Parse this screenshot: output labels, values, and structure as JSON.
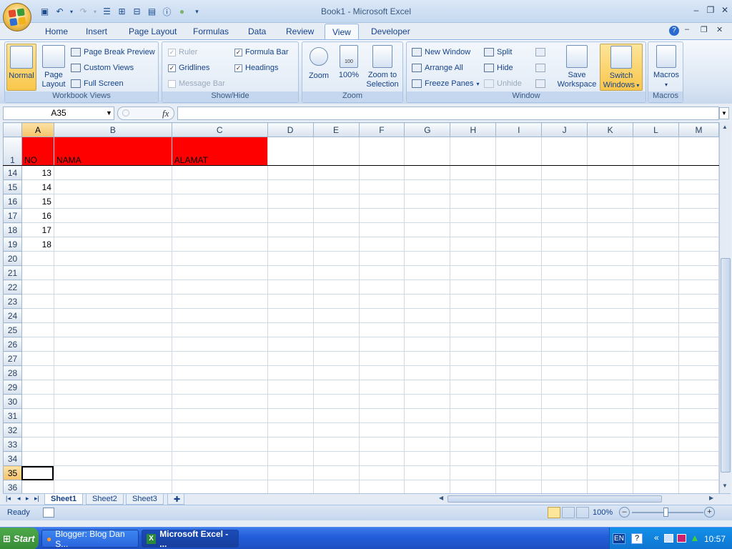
{
  "window": {
    "title": "Book1 - Microsoft Excel"
  },
  "quick_access": [
    "save-icon",
    "undo-icon",
    "redo-icon",
    "form-icon",
    "table-icon",
    "grid-icon",
    "chart-icon",
    "help-icon",
    "circle-icon"
  ],
  "tabs": [
    "Home",
    "Insert",
    "Page Layout",
    "Formulas",
    "Data",
    "Review",
    "View",
    "Developer"
  ],
  "active_tab": "View",
  "ribbon": {
    "workbook_views": {
      "label": "Workbook Views",
      "normal": "Normal",
      "page_layout_1": "Page",
      "page_layout_2": "Layout",
      "page_break_preview": "Page Break Preview",
      "custom_views": "Custom Views",
      "full_screen": "Full Screen"
    },
    "show_hide": {
      "label": "Show/Hide",
      "ruler": "Ruler",
      "gridlines": "Gridlines",
      "message_bar": "Message Bar",
      "formula_bar": "Formula Bar",
      "headings": "Headings",
      "check": "✓"
    },
    "zoom": {
      "label": "Zoom",
      "zoom": "Zoom",
      "hundred": "100%",
      "zoom_to_1": "Zoom to",
      "zoom_to_2": "Selection",
      "badge": "100"
    },
    "window": {
      "label": "Window",
      "new_window": "New Window",
      "arrange_all": "Arrange All",
      "freeze_panes": "Freeze Panes",
      "split": "Split",
      "hide": "Hide",
      "unhide": "Unhide",
      "save_ws_1": "Save",
      "save_ws_2": "Workspace",
      "switch_1": "Switch",
      "switch_2": "Windows"
    },
    "macros": {
      "label": "Macros",
      "macros": "Macros"
    }
  },
  "formula_bar": {
    "name_box": "A35",
    "fx": "fx",
    "value": ""
  },
  "grid": {
    "columns": [
      "A",
      "B",
      "C",
      "D",
      "E",
      "F",
      "G",
      "H",
      "I",
      "J",
      "K",
      "L",
      "M"
    ],
    "header_row": {
      "row": "1",
      "no": "NO",
      "nama": "NAMA",
      "alamat": "ALAMAT"
    },
    "rows": [
      {
        "row": "14",
        "a": "13"
      },
      {
        "row": "15",
        "a": "14"
      },
      {
        "row": "16",
        "a": "15"
      },
      {
        "row": "17",
        "a": "16"
      },
      {
        "row": "18",
        "a": "17"
      },
      {
        "row": "19",
        "a": "18"
      },
      {
        "row": "20",
        "a": ""
      },
      {
        "row": "21",
        "a": ""
      },
      {
        "row": "22",
        "a": ""
      },
      {
        "row": "23",
        "a": ""
      },
      {
        "row": "24",
        "a": ""
      },
      {
        "row": "25",
        "a": ""
      },
      {
        "row": "26",
        "a": ""
      },
      {
        "row": "27",
        "a": ""
      },
      {
        "row": "28",
        "a": ""
      },
      {
        "row": "29",
        "a": ""
      },
      {
        "row": "30",
        "a": ""
      },
      {
        "row": "31",
        "a": ""
      },
      {
        "row": "32",
        "a": ""
      },
      {
        "row": "33",
        "a": ""
      },
      {
        "row": "34",
        "a": ""
      },
      {
        "row": "35",
        "a": ""
      },
      {
        "row": "36",
        "a": ""
      }
    ],
    "active_cell": "A35"
  },
  "sheets": [
    "Sheet1",
    "Sheet2",
    "Sheet3"
  ],
  "active_sheet": "Sheet1",
  "status": {
    "ready": "Ready",
    "zoom": "100%"
  },
  "taskbar": {
    "start": "Start",
    "tasks": [
      "Blogger: Blog Dan S...",
      "Microsoft Excel - ..."
    ],
    "lang": "EN",
    "clock": "10:57"
  }
}
